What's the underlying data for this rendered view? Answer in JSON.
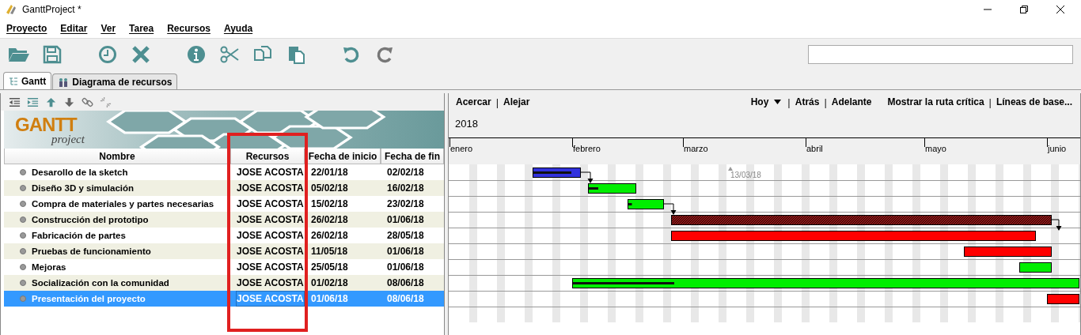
{
  "window": {
    "title": "GanttProject *"
  },
  "menu": [
    "Proyecto",
    "Editar",
    "Ver",
    "Tarea",
    "Recursos",
    "Ayuda"
  ],
  "tabs": [
    {
      "label": "Gantt",
      "selected": true
    },
    {
      "label": "Diagrama de recursos",
      "selected": false
    }
  ],
  "logo": {
    "title": "GANTT",
    "subtitle": "project"
  },
  "columns": [
    {
      "label": "Nombre",
      "highlighted": false
    },
    {
      "label": "Recursos",
      "highlighted": true
    },
    {
      "label": "Fecha de inicio",
      "highlighted": false
    },
    {
      "label": "Fecha de fin",
      "highlighted": false
    }
  ],
  "tasks": [
    {
      "name": "Desarollo de la sketch",
      "resource": "JOSE ACOSTA",
      "start": "22/01/18",
      "end": "02/02/18",
      "selected": false,
      "color": "#3333dd",
      "kind": "plain",
      "level": 0.8,
      "linked_to_next": true
    },
    {
      "name": "Diseño 3D y simulación",
      "resource": "JOSE ACOSTA",
      "start": "05/02/18",
      "end": "16/02/18",
      "selected": false,
      "color": "#00ee00",
      "kind": "plain",
      "level": 0.2,
      "linked_to_next": false
    },
    {
      "name": "Compra de materiales y partes necesarias",
      "resource": "JOSE ACOSTA",
      "start": "15/02/18",
      "end": "23/02/18",
      "selected": false,
      "color": "#00ee00",
      "kind": "plain",
      "level": 0.1,
      "linked_to_next": true
    },
    {
      "name": "Construcción del prototipo",
      "resource": "JOSE ACOSTA",
      "start": "26/02/18",
      "end": "01/06/18",
      "selected": false,
      "color": "#8b1a1a",
      "kind": "hatched",
      "level": 0,
      "linked_to_next": true
    },
    {
      "name": "Fabricación de partes",
      "resource": "JOSE ACOSTA",
      "start": "26/02/18",
      "end": "28/05/18",
      "selected": false,
      "color": "#ff0000",
      "kind": "plain",
      "level": 0,
      "linked_to_next": false
    },
    {
      "name": "Pruebas de funcionamiento",
      "resource": "JOSE ACOSTA",
      "start": "11/05/18",
      "end": "01/06/18",
      "selected": false,
      "color": "#ff0000",
      "kind": "plain",
      "level": 0,
      "linked_to_next": false
    },
    {
      "name": "Mejoras",
      "resource": "JOSE ACOSTA",
      "start": "25/05/18",
      "end": "01/06/18",
      "selected": false,
      "color": "#00ee00",
      "kind": "plain",
      "level": 0,
      "linked_to_next": false
    },
    {
      "name": "Socialización con la comunidad",
      "resource": "JOSE ACOSTA",
      "start": "01/02/18",
      "end": "08/06/18",
      "selected": false,
      "color": "#00ee00",
      "kind": "plain",
      "level": 0.2,
      "linked_to_next": false
    },
    {
      "name": "Presentación del proyecto",
      "resource": "JOSE ACOSTA",
      "start": "01/06/18",
      "end": "08/06/18",
      "selected": true,
      "color": "#ff0000",
      "kind": "plain",
      "level": 0
    }
  ],
  "chart_toolbar": {
    "left": [
      {
        "label": "Acercar",
        "kind": "link"
      },
      {
        "label": "|",
        "kind": "separator"
      },
      {
        "label": "Alejar",
        "kind": "link"
      }
    ],
    "right": [
      {
        "label": "Hoy",
        "kind": "dropdown"
      },
      {
        "label": "|",
        "kind": "separator"
      },
      {
        "label": "Atrás",
        "kind": "link"
      },
      {
        "label": "|",
        "kind": "separator"
      },
      {
        "label": "Adelante",
        "kind": "link"
      },
      {
        "label": "Mostrar la ruta crítica",
        "kind": "link"
      },
      {
        "label": "|",
        "kind": "separator"
      },
      {
        "label": "Líneas de base...",
        "kind": "link"
      }
    ]
  },
  "timeline": {
    "year": "2018",
    "months": [
      "enero",
      "febrero",
      "marzo",
      "abril",
      "mayo",
      "junio"
    ],
    "today_marker": "13/03/18"
  }
}
